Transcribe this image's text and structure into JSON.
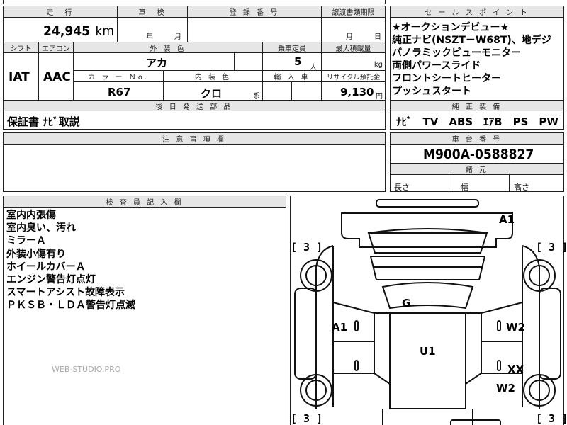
{
  "mileage": {
    "label": "走　行",
    "value": "24,945",
    "unit": "km"
  },
  "shaken": {
    "label": "車　検",
    "year_unit": "年",
    "month_unit": "月"
  },
  "registration": {
    "label": "登 録 番 号"
  },
  "transfer": {
    "label": "譲渡書類期限",
    "month_unit": "月",
    "day_unit": "日"
  },
  "shift": {
    "label": "シフト",
    "value": "IAT"
  },
  "aircon": {
    "label": "エアコン",
    "value": "AAC"
  },
  "exterior_color": {
    "label": "外 装 色",
    "value": "アカ"
  },
  "capacity": {
    "label": "乗車定員",
    "value": "5",
    "unit": "人"
  },
  "max_load": {
    "label": "最大積載量",
    "unit": "kg"
  },
  "color_no": {
    "label": "カ ラ ー Ｎo.",
    "value": "R67"
  },
  "interior_color": {
    "label": "内 装 色",
    "value": "クロ",
    "unit": "系"
  },
  "import": {
    "label": "輸 入 車"
  },
  "recycle": {
    "label": "リサイクル預託金",
    "value": "9,130",
    "unit": "円"
  },
  "later_parts": {
    "label": "後 日 発 送 部 品",
    "value": "保証書 ﾅﾋﾞ取説"
  },
  "notes": {
    "label": "注 意 事 項 欄"
  },
  "sales_points": {
    "label": "セ ー ル ス ポ イ ン ト",
    "lines": [
      "★オークションデビュー★",
      "純正ナビ(NSZT－W68T)、地デジ",
      "パノラミックビューモニター",
      "両側パワースライド",
      "フロントシートヒーター",
      "プッシュスタート"
    ]
  },
  "equipment": {
    "label": "純 正 装 備",
    "value": "ﾅﾋﾞ　TV　ABS　ｴｱB　PS　PW"
  },
  "chassis": {
    "label": "車 台 番 号",
    "value": "M900A-0588827"
  },
  "dimensions": {
    "label": "諸 元",
    "length": "長さ",
    "width": "幅",
    "height": "高さ"
  },
  "inspector": {
    "label": "検 査 員 記 入 欄",
    "lines": [
      "室内内張傷",
      "室内臭い、汚れ",
      "ミラーＡ",
      "外装小傷有り",
      "ホイールカバーＡ",
      "エンジン警告灯点灯",
      "スマートアシスト故障表示",
      "ＰＫＳＢ・ＬＤＡ警告灯点滅"
    ]
  },
  "watermark": "WEB-STUDIO.PRO",
  "diagram": {
    "marks": {
      "roof_front": "A1",
      "bonnet": "G",
      "left_door": "A1",
      "right_door_front": "W2",
      "roof": "U1",
      "right_door_rear": "XX",
      "right_rear": "W2"
    },
    "tire_front_left": "[ 3 ]",
    "tire_front_right": "[ 3 ]",
    "tire_rear_left": "[ 3 ]",
    "tire_rear_right": "[ 3 ]"
  }
}
